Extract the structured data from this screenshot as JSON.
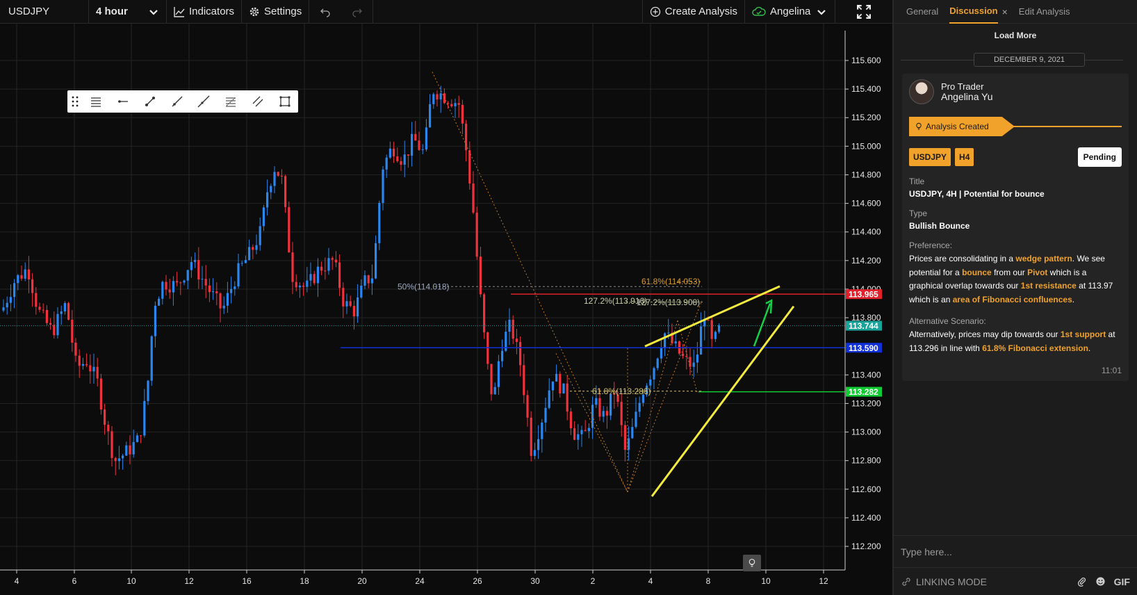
{
  "toolbar": {
    "symbol": "USDJPY",
    "interval": "4 hour",
    "indicators_label": "Indicators",
    "settings_label": "Settings",
    "create_analysis_label": "Create Analysis",
    "user_label": "Angelina"
  },
  "chart": {
    "price_labels": [
      "115.600",
      "115.400",
      "115.200",
      "115.000",
      "114.800",
      "114.600",
      "114.400",
      "114.200",
      "114.000",
      "113.800",
      "113.400",
      "113.200",
      "113.000",
      "112.800",
      "112.600",
      "112.400",
      "112.200"
    ],
    "date_labels": [
      "4",
      "6",
      "10",
      "12",
      "16",
      "18",
      "20",
      "24",
      "26",
      "30",
      "2",
      "4",
      "8",
      "10",
      "12"
    ],
    "markers": [
      {
        "value": "113.965",
        "color": "#e0202a"
      },
      {
        "value": "113.744",
        "color": "#1aa39a"
      },
      {
        "value": "113.590",
        "color": "#1030d8"
      },
      {
        "value": "113.282",
        "color": "#11cc33"
      }
    ],
    "fib_labels": {
      "f50": "50%(114.018)",
      "f618_top": "61.8%(114.053)",
      "f1272a": "127.2%(113.916)",
      "f1272b": "127.2%(113.908)",
      "f618_low": "61.8%(113.286)"
    }
  },
  "panel": {
    "tabs": [
      {
        "label": "General"
      },
      {
        "label": "Discussion"
      },
      {
        "label": "Edit Analysis"
      }
    ],
    "load_more": "Load More",
    "date": "DECEMBER 9, 2021",
    "author_role": "Pro Trader",
    "author_name": "Angelina Yu",
    "status": "Analysis Created",
    "tags": [
      "USDJPY",
      "H4"
    ],
    "pending": "Pending",
    "title_label": "Title",
    "title_value": "USDJPY, 4H | Potential for bounce",
    "type_label": "Type",
    "type_value": "Bullish Bounce",
    "preference_label": "Preference:",
    "alt_label": "Alternative Scenario:",
    "time": "11:01",
    "composer_placeholder": "Type here...",
    "linking_mode": "LINKING MODE",
    "gif": "GIF",
    "preference_text": {
      "t1": "Prices are consolidating in a ",
      "h1": "wedge pattern",
      "t2": ". We see potential for a ",
      "h2": "bounce",
      "t3": " from our ",
      "h3": "Pivot",
      "t4": " which is a graphical overlap towards our ",
      "h4": "1st resistance",
      "t5": " at 113.97 which is an ",
      "h5": "area of Fibonacci confluences",
      "t6": "."
    },
    "alt_text": {
      "t1": "Alternatively, prices may dip towards our ",
      "h1": "1st support",
      "t2": " at 113.296 in line with ",
      "h2": "61.8% Fibonacci extension",
      "t3": "."
    }
  }
}
